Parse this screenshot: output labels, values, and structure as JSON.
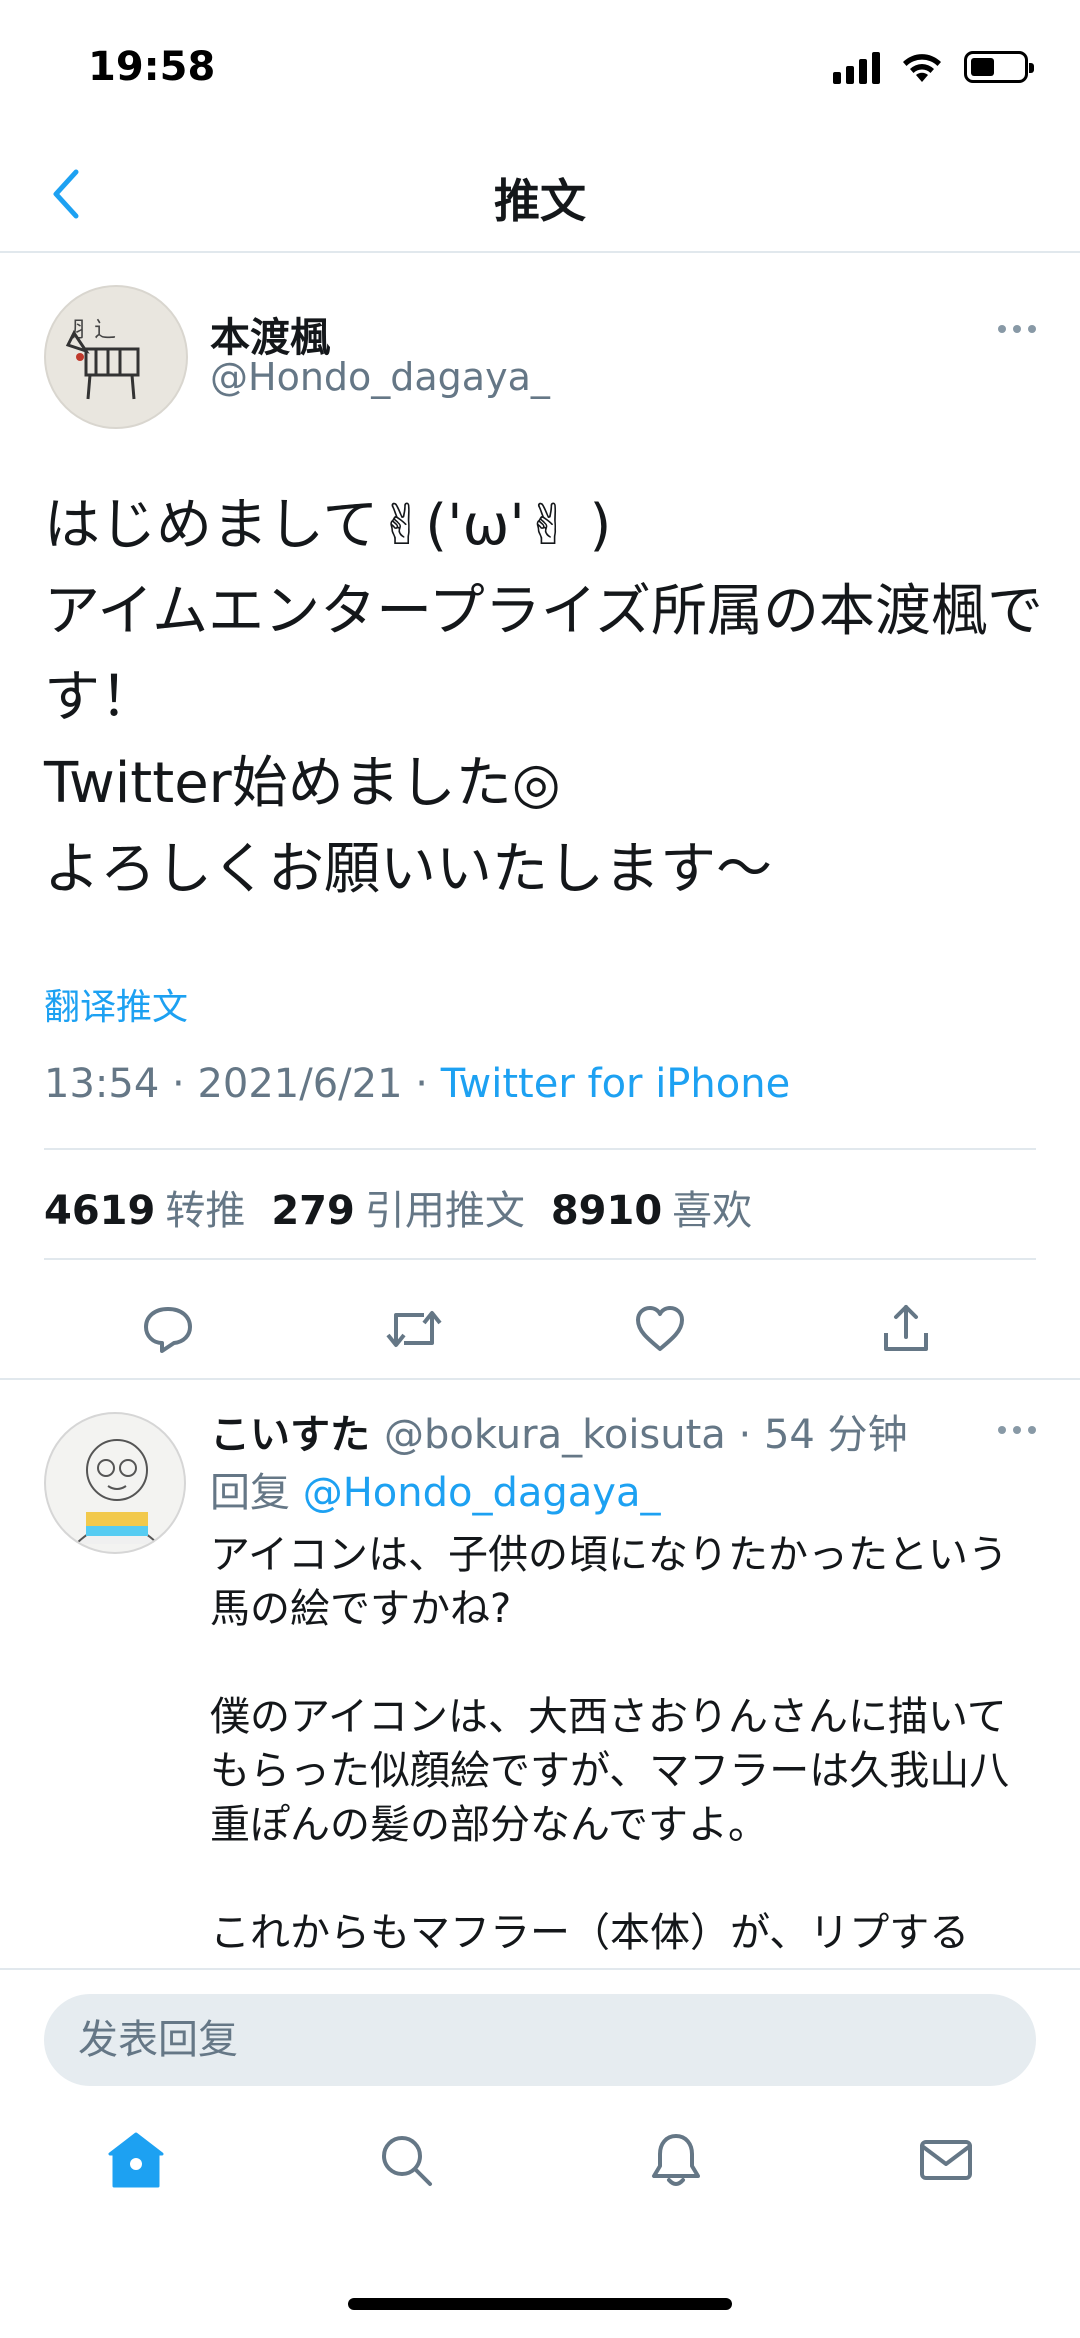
{
  "status_bar": {
    "time": "19:58"
  },
  "nav": {
    "title": "推文"
  },
  "tweet": {
    "author_name": "本渡楓",
    "author_handle": "@Hondo_dagaya_",
    "text": "はじめまして✌︎('ω'✌︎ )\nアイムエンタープライズ所属の本渡楓です！\nTwitter始めました◎\nよろしくお願いいたします〜",
    "translate_label": "翻译推文",
    "time": "13:54",
    "date": "2021/6/21",
    "source": "Twitter for iPhone",
    "stats": {
      "retweets_count": "4619",
      "retweets_label": "转推",
      "quotes_count": "279",
      "quotes_label": "引用推文",
      "likes_count": "8910",
      "likes_label": "喜欢"
    }
  },
  "reply": {
    "author_name": "こいすた",
    "author_handle": "@bokura_koisuta",
    "age": "54 分钟",
    "reply_to_label": "回复",
    "reply_to_handle": "@Hondo_dagaya_",
    "text": "アイコンは、子供の頃になりたかったという馬の絵ですかね?\n\n僕のアイコンは、大西さおりんさんに描いてもらった似顔絵ですが、マフラーは久我山八重ぽんの髪の部分なんですよ。\n\nこれからもマフラー（本体）が、リプする"
  },
  "compose": {
    "placeholder": "发表回复"
  },
  "icons": {
    "back": "chevron-left-icon",
    "reply": "reply-icon",
    "retweet": "retweet-icon",
    "like": "heart-icon",
    "share": "share-icon",
    "home": "home-icon",
    "search": "search-icon",
    "notifications": "bell-icon",
    "messages": "mail-icon"
  },
  "colors": {
    "accent": "#1da1f2",
    "secondary_text": "#657786",
    "divider": "#e1e8ed"
  }
}
